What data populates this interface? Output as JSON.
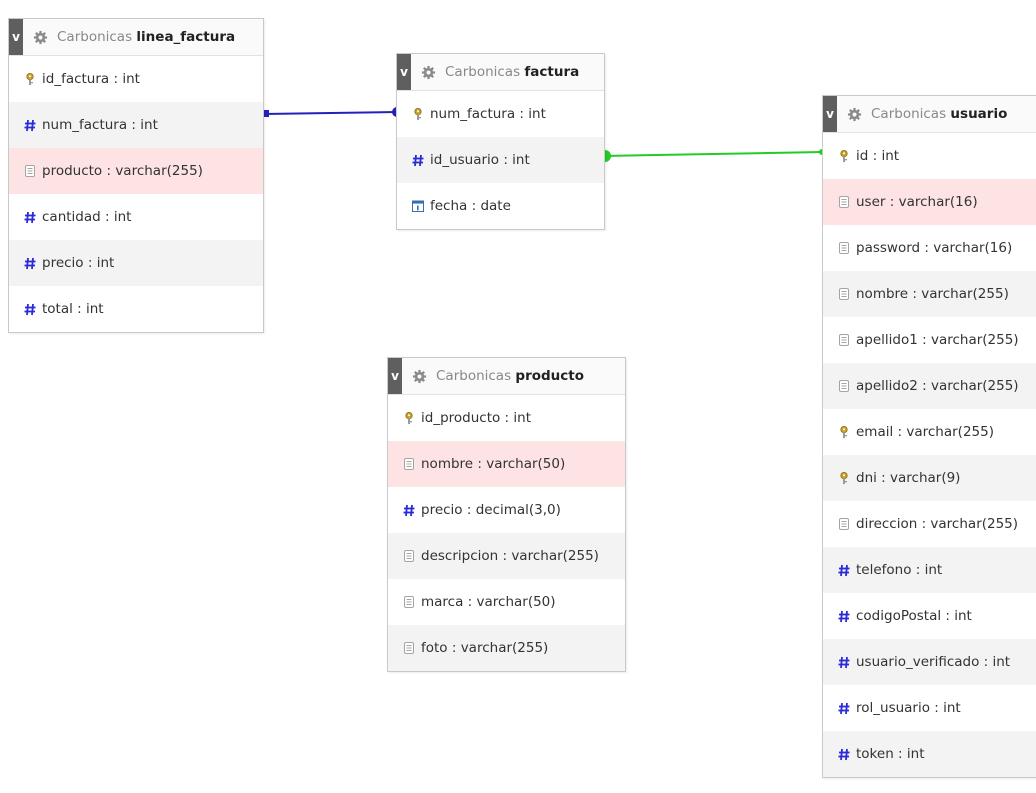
{
  "colors": {
    "link_blue": "#2222bb",
    "link_green": "#22cc22",
    "row_highlight": "#fde3e3",
    "row_alt": "#f3f3f3",
    "header_toggle": "#5f5f5f"
  },
  "tables": {
    "linea_factura": {
      "toggle": "v",
      "db": "Carbonicas",
      "name": "linea_factura",
      "fields": [
        {
          "label": "id_factura : int",
          "icon": "key-icon"
        },
        {
          "label": "num_factura : int",
          "icon": "hash-icon"
        },
        {
          "label": "producto : varchar(255)",
          "icon": "text-icon"
        },
        {
          "label": "cantidad : int",
          "icon": "hash-icon"
        },
        {
          "label": "precio : int",
          "icon": "hash-icon"
        },
        {
          "label": "total : int",
          "icon": "hash-icon"
        }
      ]
    },
    "factura": {
      "toggle": "v",
      "db": "Carbonicas",
      "name": "factura",
      "fields": [
        {
          "label": "num_factura : int",
          "icon": "key-icon"
        },
        {
          "label": "id_usuario : int",
          "icon": "hash-icon"
        },
        {
          "label": "fecha : date",
          "icon": "calendar-icon"
        }
      ]
    },
    "producto": {
      "toggle": "v",
      "db": "Carbonicas",
      "name": "producto",
      "fields": [
        {
          "label": "id_producto : int",
          "icon": "key-icon"
        },
        {
          "label": "nombre : varchar(50)",
          "icon": "text-icon"
        },
        {
          "label": "precio : decimal(3,0)",
          "icon": "hash-icon"
        },
        {
          "label": "descripcion : varchar(255)",
          "icon": "text-icon"
        },
        {
          "label": "marca : varchar(50)",
          "icon": "text-icon"
        },
        {
          "label": "foto : varchar(255)",
          "icon": "text-icon"
        }
      ]
    },
    "usuario": {
      "toggle": "v",
      "db": "Carbonicas",
      "name": "usuario",
      "fields": [
        {
          "label": "id : int",
          "icon": "key-icon"
        },
        {
          "label": "user : varchar(16)",
          "icon": "text-icon"
        },
        {
          "label": "password : varchar(16)",
          "icon": "text-icon"
        },
        {
          "label": "nombre : varchar(255)",
          "icon": "text-icon"
        },
        {
          "label": "apellido1 : varchar(255)",
          "icon": "text-icon"
        },
        {
          "label": "apellido2 : varchar(255)",
          "icon": "text-icon"
        },
        {
          "label": "email : varchar(255)",
          "icon": "key-icon"
        },
        {
          "label": "dni : varchar(9)",
          "icon": "key-icon"
        },
        {
          "label": "direccion : varchar(255)",
          "icon": "text-icon"
        },
        {
          "label": "telefono : int",
          "icon": "hash-icon"
        },
        {
          "label": "codigoPostal : int",
          "icon": "hash-icon"
        },
        {
          "label": "usuario_verificado : int",
          "icon": "hash-icon"
        },
        {
          "label": "rol_usuario : int",
          "icon": "hash-icon"
        },
        {
          "label": "token : int",
          "icon": "hash-icon"
        }
      ]
    }
  }
}
